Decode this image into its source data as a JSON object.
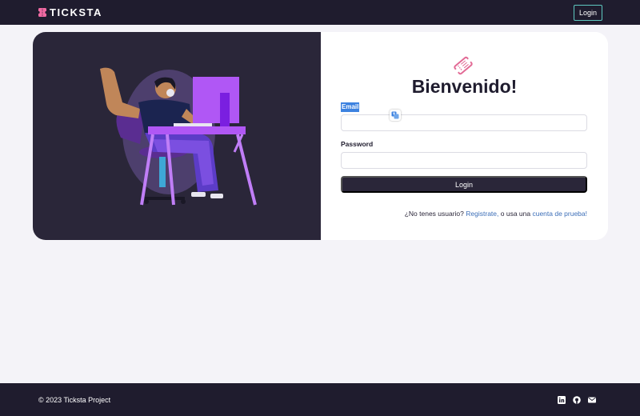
{
  "navbar": {
    "brand_text": "TICKSTA",
    "login_label": "Login"
  },
  "login_card": {
    "welcome_title": "Bienvenido!",
    "email_label": "Email",
    "email_value": "",
    "password_label": "Password",
    "password_value": "",
    "submit_label": "Login",
    "signup_prefix": "¿No tenes usuario?",
    "signup_link": "Registrate,",
    "signup_middle": "o usa una",
    "demo_link": "cuenta de prueba!"
  },
  "footer": {
    "copyright": "© 2023 Ticksta Project",
    "socials": [
      "linkedin-icon",
      "github-icon",
      "mail-icon"
    ]
  },
  "colors": {
    "nav_bg": "#1f1c2e",
    "page_bg": "#f4f3f8",
    "illustration_bg": "#2a2639",
    "accent_purple": "#b057f5",
    "brand_pink": "#f06aa2",
    "link_blue": "#3d6fb8",
    "nav_login_border": "#5ec8c0"
  }
}
